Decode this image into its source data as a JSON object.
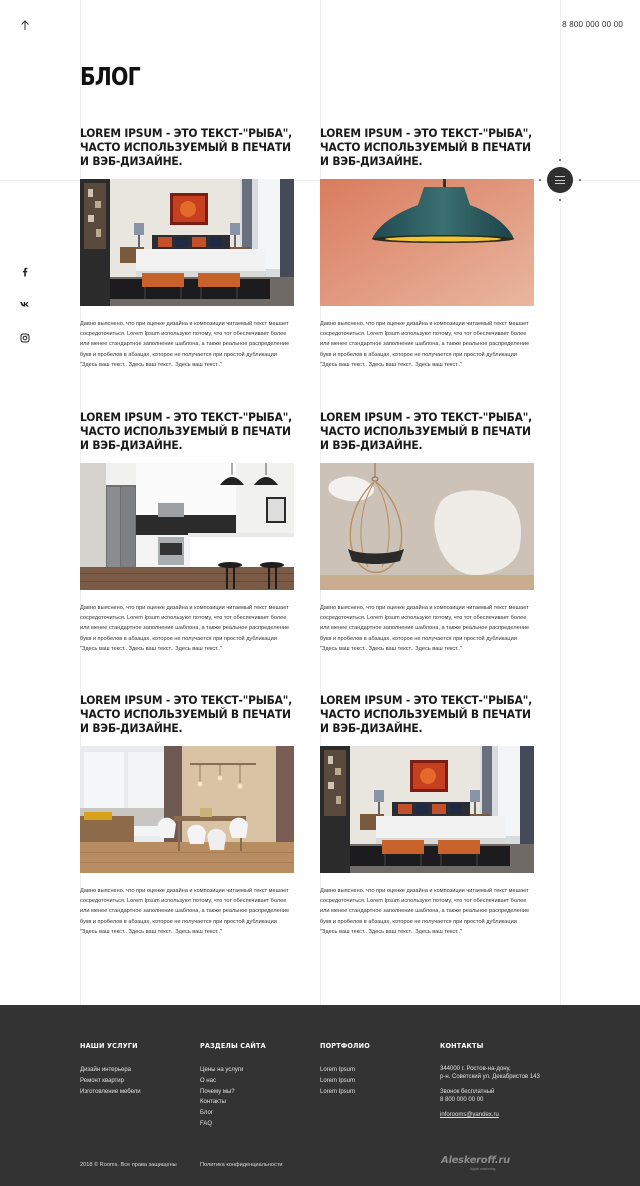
{
  "header": {
    "phone": "8 800 000 00 00"
  },
  "page": {
    "title": "БЛОГ"
  },
  "posts": [
    {
      "title": "LOREM IPSUM - ЭТО ТЕКСТ-\"РЫБА\", ЧАСТО ИСПОЛЬЗУЕМЫЙ В ПЕЧАТИ И ВЭБ-ДИЗАЙНЕ.",
      "image": "bedroom",
      "excerpt": "Давно выяснено, что при оценке дизайна и композиции читаемый текст мешает сосредоточиться. Lorem Ipsum используют потому, что тот обеспечивает более или менее стандартное заполнение шаблона, а также реальное распределение букв и пробелов в абзацах, которое не получается при простой дубликации \"Здесь ваш текст.. Здесь ваш текст.. Здесь ваш текст..\""
    },
    {
      "title": "LOREM IPSUM - ЭТО ТЕКСТ-\"РЫБА\", ЧАСТО ИСПОЛЬЗУЕМЫЙ В ПЕЧАТИ И ВЭБ-ДИЗАЙНЕ.",
      "image": "lamp",
      "excerpt": "Давно выяснено, что при оценке дизайна и композиции читаемый текст мешает сосредоточиться. Lorem Ipsum используют потому, что тот обеспечивает более или менее стандартное заполнение шаблона, а также реальное распределение букв и пробелов в абзацах, которое не получается при простой дубликации \"Здесь ваш текст.. Здесь ваш текст.. Здесь ваш текст..\""
    },
    {
      "title": "LOREM IPSUM - ЭТО ТЕКСТ-\"РЫБА\", ЧАСТО ИСПОЛЬЗУЕМЫЙ В ПЕЧАТИ И ВЭБ-ДИЗАЙНЕ.",
      "image": "kitchen",
      "excerpt": "Давно выяснено, что при оценке дизайна и композиции читаемый текст мешает сосредоточиться. Lorem Ipsum используют потому, что тот обеспечивает более или менее стандартное заполнение шаблона, а также реальное распределение букв и пробелов в абзацах, которое не получается при простой дубликации \"Здесь ваш текст.. Здесь ваш текст.. Здесь ваш текст..\""
    },
    {
      "title": "LOREM IPSUM - ЭТО ТЕКСТ-\"РЫБА\", ЧАСТО ИСПОЛЬЗУЕМЫЙ В ПЕЧАТИ И ВЭБ-ДИЗАЙНЕ.",
      "image": "hanging-chair",
      "excerpt": "Давно выяснено, что при оценке дизайна и композиции читаемый текст мешает сосредоточиться. Lorem Ipsum используют потому, что тот обеспечивает более или менее стандартное заполнение шаблона, а также реальное распределение букв и пробелов в абзацах, которое не получается при простой дубликации \"Здесь ваш текст.. Здесь ваш текст.. Здесь ваш текст..\""
    },
    {
      "title": "LOREM IPSUM - ЭТО ТЕКСТ-\"РЫБА\", ЧАСТО ИСПОЛЬЗУЕМЫЙ В ПЕЧАТИ И ВЭБ-ДИЗАЙНЕ.",
      "image": "dining-room",
      "excerpt": "Давно выяснено, что при оценке дизайна и композиции читаемый текст мешает сосредоточиться. Lorem Ipsum используют потому, что тот обеспечивает более или менее стандартное заполнение шаблона, а также реальное распределение букв и пробелов в абзацах, которое не получается при простой дубликации \"Здесь ваш текст.. Здесь ваш текст.. Здесь ваш текст..\""
    },
    {
      "title": "LOREM IPSUM - ЭТО ТЕКСТ-\"РЫБА\", ЧАСТО ИСПОЛЬЗУЕМЫЙ В ПЕЧАТИ И ВЭБ-ДИЗАЙНЕ.",
      "image": "bedroom",
      "excerpt": "Давно выяснено, что при оценке дизайна и композиции читаемый текст мешает сосредоточиться. Lorem Ipsum используют потому, что тот обеспечивает более или менее стандартное заполнение шаблона, а также реальное распределение букв и пробелов в абзацах, которое не получается при простой дубликации \"Здесь ваш текст.. Здесь ваш текст.. Здесь ваш текст..\""
    }
  ],
  "social": [
    {
      "name": "facebook-icon",
      "glyph": "f"
    },
    {
      "name": "vk-icon",
      "glyph": "vk"
    },
    {
      "name": "instagram-icon",
      "glyph": "ig"
    }
  ],
  "footer": {
    "services": {
      "heading": "НАШИ УСЛУГИ",
      "links": [
        "Дизайн интерьера",
        "Ремонт квартир",
        "Изготовление мебели"
      ]
    },
    "sections": {
      "heading": "РАЗДЕЛЫ САЙТА",
      "links": [
        "Цены на услуги",
        "О нас",
        "Почему мы?",
        "Контакты",
        "Блог",
        "FAQ"
      ]
    },
    "portfolio": {
      "heading": "ПОРТФОЛИО",
      "links": [
        "Lorem Ipsum",
        "Lorem Ipsum",
        "Lorem Ipsum"
      ]
    },
    "contacts": {
      "heading": "КОНТАКТЫ",
      "address_line1": "344000 г. Ростов-на-дону,",
      "address_line2": "р-н. Советский ул. Декабристов 143",
      "phone_label": "Звонок бесплатный",
      "phone": "8 800 000 00 00",
      "email": "inforooms@yandex.ru"
    },
    "copyright": "2018 © Rooms. Все права защищены",
    "policy": "Политика конфиденциальности",
    "developer": "Aleskeroff.ru",
    "developer_sub": "digital marketing"
  },
  "colors": {
    "footer_bg": "#333333",
    "menu_button": "#2f2f2f",
    "text": "#1a1a1a"
  }
}
